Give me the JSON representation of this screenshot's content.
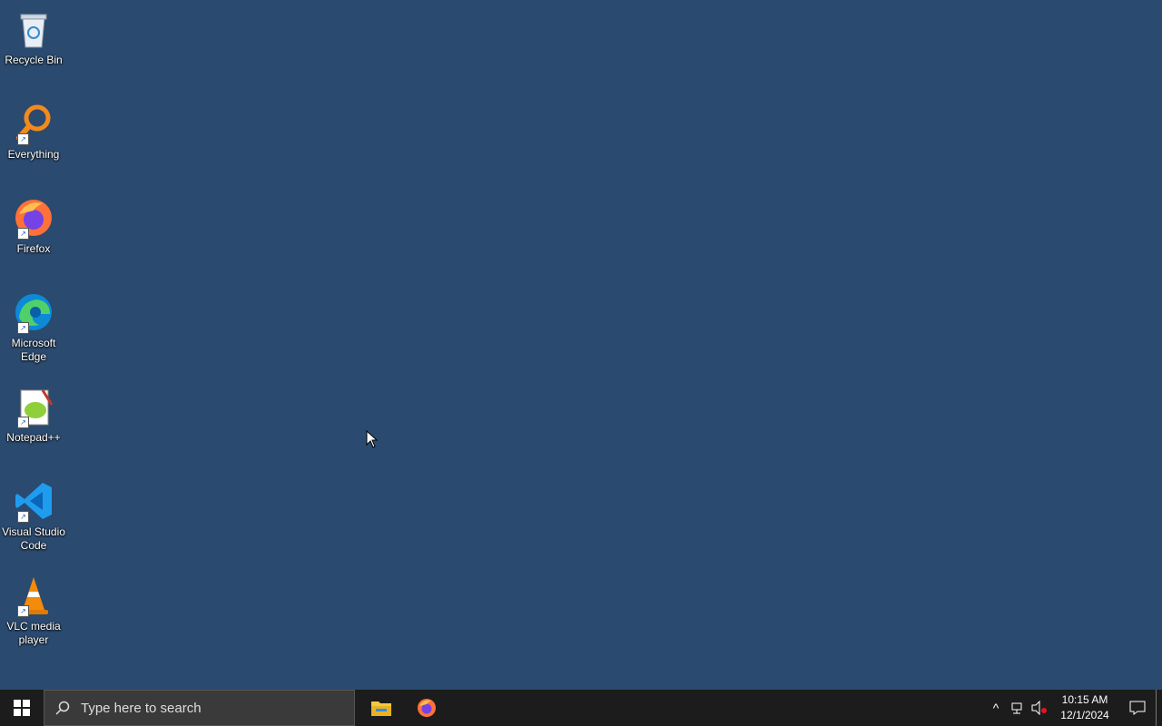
{
  "desktop": {
    "icons": [
      {
        "label": "Recycle Bin",
        "icon": "recycle-bin-icon",
        "shortcut": false
      },
      {
        "label": "Everything",
        "icon": "everything-search-icon",
        "shortcut": true
      },
      {
        "label": "Firefox",
        "icon": "firefox-icon",
        "shortcut": true
      },
      {
        "label": "Microsoft Edge",
        "icon": "edge-icon",
        "shortcut": true
      },
      {
        "label": "Notepad++",
        "icon": "notepad-plus-plus-icon",
        "shortcut": true
      },
      {
        "label": "Visual Studio Code",
        "icon": "vscode-icon",
        "shortcut": true
      },
      {
        "label": "VLC media player",
        "icon": "vlc-icon",
        "shortcut": true
      }
    ]
  },
  "taskbar": {
    "search_placeholder": "Type here to search",
    "pinned": [
      "file-explorer-icon",
      "firefox-icon"
    ],
    "clock": {
      "time": "10:15 AM",
      "date": "12/1/2024"
    }
  },
  "colors": {
    "taskbar": "#1c1c1c",
    "windows_blue": "#0078d4"
  }
}
